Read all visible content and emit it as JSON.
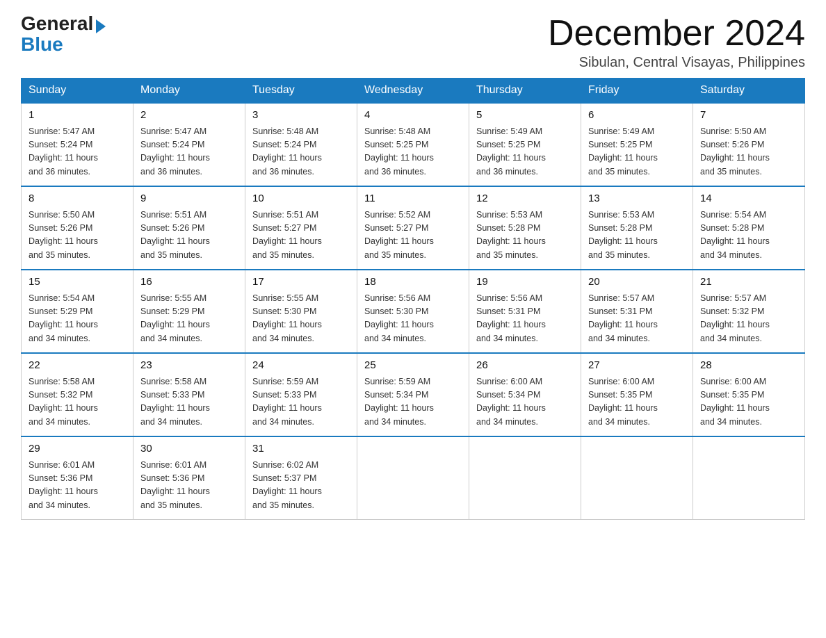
{
  "logo": {
    "general": "General",
    "blue": "Blue"
  },
  "title": "December 2024",
  "location": "Sibulan, Central Visayas, Philippines",
  "days_of_week": [
    "Sunday",
    "Monday",
    "Tuesday",
    "Wednesday",
    "Thursday",
    "Friday",
    "Saturday"
  ],
  "weeks": [
    [
      {
        "day": "1",
        "sunrise": "5:47 AM",
        "sunset": "5:24 PM",
        "daylight": "11 hours and 36 minutes."
      },
      {
        "day": "2",
        "sunrise": "5:47 AM",
        "sunset": "5:24 PM",
        "daylight": "11 hours and 36 minutes."
      },
      {
        "day": "3",
        "sunrise": "5:48 AM",
        "sunset": "5:24 PM",
        "daylight": "11 hours and 36 minutes."
      },
      {
        "day": "4",
        "sunrise": "5:48 AM",
        "sunset": "5:25 PM",
        "daylight": "11 hours and 36 minutes."
      },
      {
        "day": "5",
        "sunrise": "5:49 AM",
        "sunset": "5:25 PM",
        "daylight": "11 hours and 36 minutes."
      },
      {
        "day": "6",
        "sunrise": "5:49 AM",
        "sunset": "5:25 PM",
        "daylight": "11 hours and 35 minutes."
      },
      {
        "day": "7",
        "sunrise": "5:50 AM",
        "sunset": "5:26 PM",
        "daylight": "11 hours and 35 minutes."
      }
    ],
    [
      {
        "day": "8",
        "sunrise": "5:50 AM",
        "sunset": "5:26 PM",
        "daylight": "11 hours and 35 minutes."
      },
      {
        "day": "9",
        "sunrise": "5:51 AM",
        "sunset": "5:26 PM",
        "daylight": "11 hours and 35 minutes."
      },
      {
        "day": "10",
        "sunrise": "5:51 AM",
        "sunset": "5:27 PM",
        "daylight": "11 hours and 35 minutes."
      },
      {
        "day": "11",
        "sunrise": "5:52 AM",
        "sunset": "5:27 PM",
        "daylight": "11 hours and 35 minutes."
      },
      {
        "day": "12",
        "sunrise": "5:53 AM",
        "sunset": "5:28 PM",
        "daylight": "11 hours and 35 minutes."
      },
      {
        "day": "13",
        "sunrise": "5:53 AM",
        "sunset": "5:28 PM",
        "daylight": "11 hours and 35 minutes."
      },
      {
        "day": "14",
        "sunrise": "5:54 AM",
        "sunset": "5:28 PM",
        "daylight": "11 hours and 34 minutes."
      }
    ],
    [
      {
        "day": "15",
        "sunrise": "5:54 AM",
        "sunset": "5:29 PM",
        "daylight": "11 hours and 34 minutes."
      },
      {
        "day": "16",
        "sunrise": "5:55 AM",
        "sunset": "5:29 PM",
        "daylight": "11 hours and 34 minutes."
      },
      {
        "day": "17",
        "sunrise": "5:55 AM",
        "sunset": "5:30 PM",
        "daylight": "11 hours and 34 minutes."
      },
      {
        "day": "18",
        "sunrise": "5:56 AM",
        "sunset": "5:30 PM",
        "daylight": "11 hours and 34 minutes."
      },
      {
        "day": "19",
        "sunrise": "5:56 AM",
        "sunset": "5:31 PM",
        "daylight": "11 hours and 34 minutes."
      },
      {
        "day": "20",
        "sunrise": "5:57 AM",
        "sunset": "5:31 PM",
        "daylight": "11 hours and 34 minutes."
      },
      {
        "day": "21",
        "sunrise": "5:57 AM",
        "sunset": "5:32 PM",
        "daylight": "11 hours and 34 minutes."
      }
    ],
    [
      {
        "day": "22",
        "sunrise": "5:58 AM",
        "sunset": "5:32 PM",
        "daylight": "11 hours and 34 minutes."
      },
      {
        "day": "23",
        "sunrise": "5:58 AM",
        "sunset": "5:33 PM",
        "daylight": "11 hours and 34 minutes."
      },
      {
        "day": "24",
        "sunrise": "5:59 AM",
        "sunset": "5:33 PM",
        "daylight": "11 hours and 34 minutes."
      },
      {
        "day": "25",
        "sunrise": "5:59 AM",
        "sunset": "5:34 PM",
        "daylight": "11 hours and 34 minutes."
      },
      {
        "day": "26",
        "sunrise": "6:00 AM",
        "sunset": "5:34 PM",
        "daylight": "11 hours and 34 minutes."
      },
      {
        "day": "27",
        "sunrise": "6:00 AM",
        "sunset": "5:35 PM",
        "daylight": "11 hours and 34 minutes."
      },
      {
        "day": "28",
        "sunrise": "6:00 AM",
        "sunset": "5:35 PM",
        "daylight": "11 hours and 34 minutes."
      }
    ],
    [
      {
        "day": "29",
        "sunrise": "6:01 AM",
        "sunset": "5:36 PM",
        "daylight": "11 hours and 34 minutes."
      },
      {
        "day": "30",
        "sunrise": "6:01 AM",
        "sunset": "5:36 PM",
        "daylight": "11 hours and 35 minutes."
      },
      {
        "day": "31",
        "sunrise": "6:02 AM",
        "sunset": "5:37 PM",
        "daylight": "11 hours and 35 minutes."
      },
      null,
      null,
      null,
      null
    ]
  ],
  "labels": {
    "sunrise": "Sunrise:",
    "sunset": "Sunset:",
    "daylight": "Daylight:"
  }
}
